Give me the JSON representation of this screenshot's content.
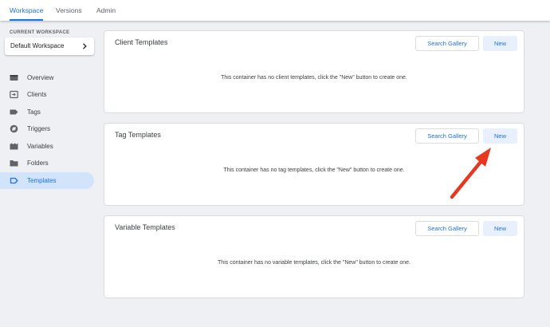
{
  "topnav": {
    "tabs": [
      {
        "label": "Workspace",
        "active": true
      },
      {
        "label": "Versions",
        "active": false
      },
      {
        "label": "Admin",
        "active": false
      }
    ]
  },
  "sidebar": {
    "workspace_label": "CURRENT WORKSPACE",
    "workspace_name": "Default Workspace",
    "items": [
      {
        "label": "Overview",
        "icon": "overview-icon"
      },
      {
        "label": "Clients",
        "icon": "clients-icon"
      },
      {
        "label": "Tags",
        "icon": "tag-icon"
      },
      {
        "label": "Triggers",
        "icon": "trigger-icon"
      },
      {
        "label": "Variables",
        "icon": "variables-icon"
      },
      {
        "label": "Folders",
        "icon": "folder-icon"
      },
      {
        "label": "Templates",
        "icon": "template-icon",
        "active": true
      }
    ]
  },
  "sections": [
    {
      "title": "Client Templates",
      "gallery_label": "Search Gallery",
      "new_label": "New",
      "empty_text": "This container has no client templates, click the \"New\" button to create one."
    },
    {
      "title": "Tag Templates",
      "gallery_label": "Search Gallery",
      "new_label": "New",
      "empty_text": "This container has no tag templates, click the \"New\" button to create one."
    },
    {
      "title": "Variable Templates",
      "gallery_label": "Search Gallery",
      "new_label": "New",
      "empty_text": "This container has no variable templates, click the \"New\" button to create one."
    }
  ],
  "colors": {
    "accent": "#1a73e8",
    "annotation_arrow": "#e8371f"
  }
}
